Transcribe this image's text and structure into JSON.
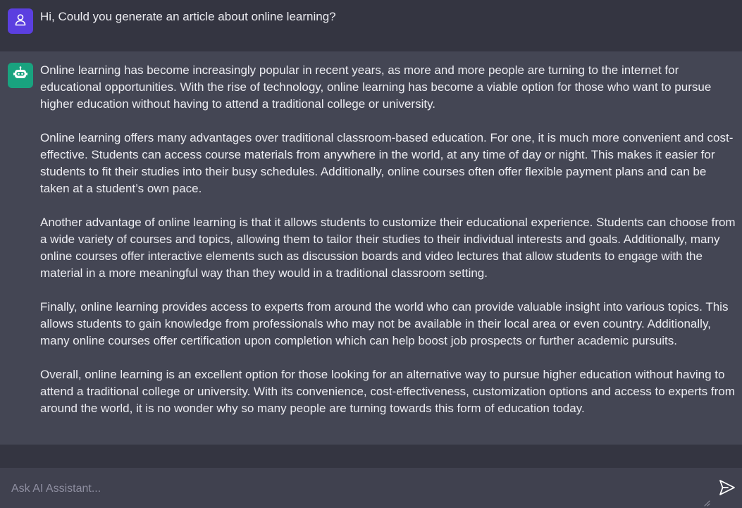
{
  "conversation": {
    "user_message": {
      "icon": "user-icon",
      "text": "Hi, Could you generate an article about online learning?"
    },
    "assistant_message": {
      "icon": "robot-icon",
      "paragraphs": [
        " Online learning has become increasingly popular in recent years, as more and more people are turning to the internet for educational opportunities. With the rise of technology, online learning has become a viable option for those who want to pursue higher education without having to attend a traditional college or university.",
        "Online learning offers many advantages over traditional classroom-based education. For one, it is much more convenient and cost-effective. Students can access course materials from anywhere in the world, at any time of day or night. This makes it easier for students to fit their studies into their busy schedules. Additionally, online courses often offer flexible payment plans and can be taken at a student’s own pace.",
        "Another advantage of online learning is that it allows students to customize their educational experience. Students can choose from a wide variety of courses and topics, allowing them to tailor their studies to their individual interests and goals. Additionally, many online courses offer interactive elements such as discussion boards and video lectures that allow students to engage with the material in a more meaningful way than they would in a traditional classroom setting.",
        "Finally, online learning provides access to experts from around the world who can provide valuable insight into various topics. This allows students to gain knowledge from professionals who may not be available in their local area or even country. Additionally, many online courses offer certification upon completion which can help boost job prospects or further academic pursuits.",
        "Overall, online learning is an excellent option for those looking for an alternative way to pursue higher education without having to attend a traditional college or university. With its convenience, cost-effectiveness, customization options and access to experts from around the world, it is no wonder why so many people are turning towards this form of education today."
      ]
    }
  },
  "composer": {
    "placeholder": "Ask AI Assistant...",
    "value": "",
    "send_icon": "send-icon"
  },
  "colors": {
    "user_avatar": "#5b3fe0",
    "assistant_avatar": "#19a37f",
    "user_row_bg": "#343541",
    "assistant_row_bg": "#444654",
    "composer_bg": "#40414f"
  }
}
